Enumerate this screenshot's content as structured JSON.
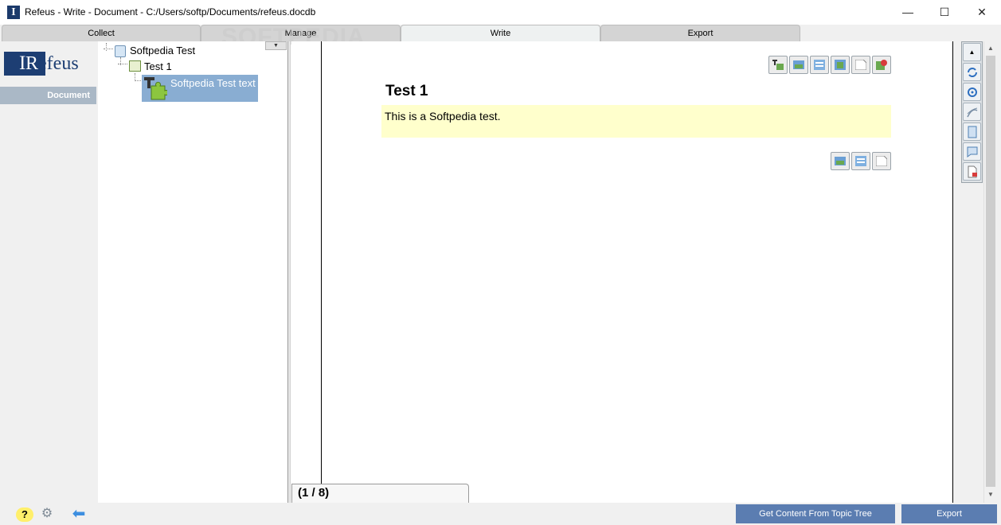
{
  "window": {
    "title": "Refeus - Write - Document - C:/Users/softp/Documents/refeus.docdb",
    "app_icon_letter": "I",
    "minimize": "—",
    "maximize": "☐",
    "close": "✕"
  },
  "watermark": "SOFTPEDIA",
  "tabs": [
    {
      "label": "Collect"
    },
    {
      "label": "Manage"
    },
    {
      "label": "Write"
    },
    {
      "label": "Export"
    }
  ],
  "logo": {
    "prefix": "I",
    "letter": "R",
    "rest": "efeus"
  },
  "nav": {
    "document": "Document"
  },
  "tree": {
    "dropdown": "▼",
    "root": "Softpedia Test",
    "child": "Test 1",
    "leaf": "Softpedia Test text"
  },
  "document": {
    "title": "Test 1",
    "paragraph": "This is a Softpedia test.",
    "page_counter": "(1 / 8)"
  },
  "scroll": {
    "up": "▲",
    "down": "▼"
  },
  "bottom": {
    "help": "?",
    "gear": "⚙",
    "back": "⬅",
    "get_content": "Get Content From Topic Tree",
    "export": "Export"
  },
  "colors": {
    "accent": "#5b7db1",
    "selection": "#89add2",
    "paragraph_bg": "#ffffcc",
    "logo": "#1d3e73"
  }
}
